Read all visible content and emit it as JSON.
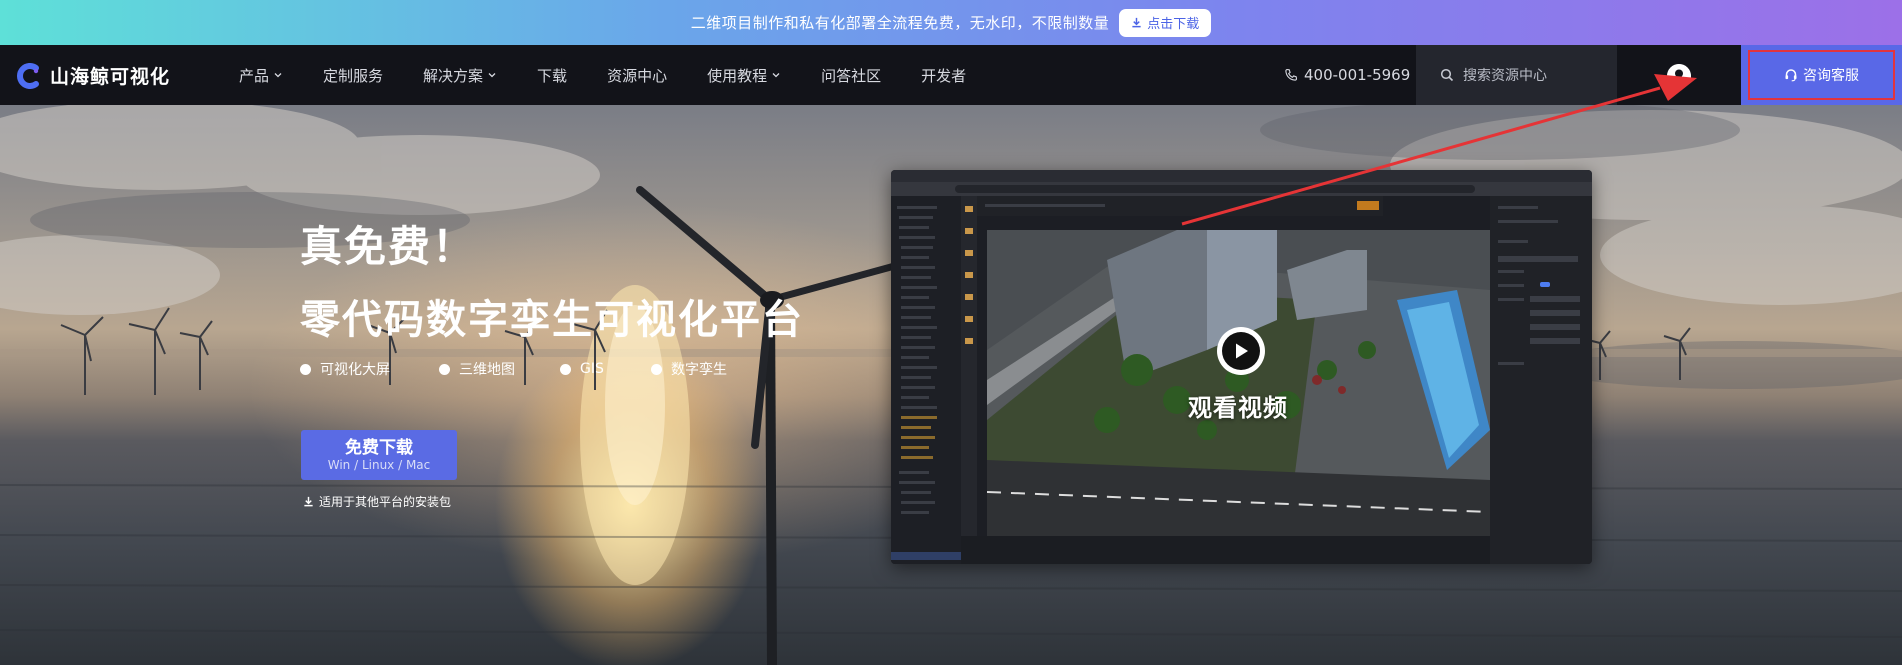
{
  "promo": {
    "text": "二维项目制作和私有化部署全流程免费，无水印，不限制数量",
    "button": "点击下载"
  },
  "brand": {
    "name": "山海鲸可视化",
    "accent": "#5968e7"
  },
  "nav": {
    "items": [
      {
        "label": "产品",
        "dropdown": true
      },
      {
        "label": "定制服务",
        "dropdown": false
      },
      {
        "label": "解决方案",
        "dropdown": true
      },
      {
        "label": "下载",
        "dropdown": false
      },
      {
        "label": "资源中心",
        "dropdown": false
      },
      {
        "label": "使用教程",
        "dropdown": true
      },
      {
        "label": "问答社区",
        "dropdown": false
      },
      {
        "label": "开发者",
        "dropdown": false
      }
    ],
    "phone": "400-001-5969",
    "search_placeholder": "搜索资源中心",
    "consult": "咨询客服"
  },
  "hero": {
    "title1": "真免费！",
    "title2": "零代码数字孪生可视化平台",
    "features": [
      "可视化大屏",
      "三维地图",
      "GIS",
      "数字孪生"
    ],
    "download": {
      "label": "免费下载",
      "platforms": "Win / Linux / Mac"
    },
    "other_platforms": "适用于其他平台的安装包"
  },
  "video": {
    "label": "观看视频"
  },
  "icons": [
    "logo-icon",
    "download-icon",
    "chevron-down-icon",
    "phone-icon",
    "search-icon",
    "user-icon",
    "headset-icon",
    "play-icon"
  ]
}
